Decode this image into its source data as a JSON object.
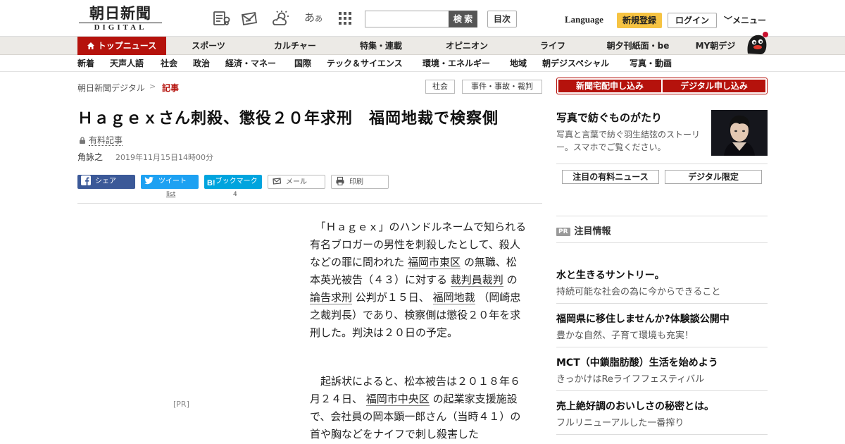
{
  "header": {
    "logo_jp": "朝日新聞",
    "logo_sub": "DIGITAL",
    "font_icon_big": "あ",
    "font_icon_small": "あ",
    "search_placeholder": "",
    "search_label": "検 索",
    "toc_label": "目次",
    "language_label": "Language",
    "signup_label": "新規登録",
    "login_label": "ログイン",
    "menu_label": "メニュー"
  },
  "main_nav": [
    "トップニュース",
    "スポーツ",
    "カルチャー",
    "特集・連載",
    "オピニオン",
    "ライフ",
    "朝夕刊紙面・be",
    "MY朝デジ"
  ],
  "sub_nav": [
    "新着",
    "天声人語",
    "社会",
    "政治",
    "経済・マネー",
    "国際",
    "テック＆サイエンス",
    "環境・エネルギー",
    "地域",
    "朝デジスペシャル",
    "写真・動画"
  ],
  "breadcrumb": {
    "root": "朝日新聞デジタル",
    "sep": ">",
    "current": "記事"
  },
  "tags": [
    "社会",
    "事件・事故・裁判"
  ],
  "article": {
    "title": "Ｈａｇｅｘさん刺殺、懲役２０年求刑　福岡地裁で検察側",
    "paid_label": "有料記事",
    "author": "角詠之",
    "date": "2019年11月15日14時00分",
    "share": {
      "facebook": "シェア",
      "twitter": "ツイート",
      "hatena": "ブックマーク",
      "mail": "メール",
      "print": "印刷",
      "twitter_count": "list",
      "hatena_count": "4"
    },
    "ad_label": "[PR]",
    "p1": {
      "t1": "「Ｈａｇｅｘ」のハンドルネームで知られる有名ブロガーの男性を刺殺したとして、殺人などの罪に問われた ",
      "l1": "福岡市東区",
      "t2": " の無職、松本英光被告（４３）に対する ",
      "l2": "裁判員裁判",
      "t3": " の ",
      "l3": "論告求刑",
      "t4": " 公判が１５日、 ",
      "l4": "福岡地裁",
      "t5": " （岡崎忠之裁判長）であり、検察側は懲役２０年を求刑した。判決は２０日の予定。"
    },
    "p2": {
      "t1": "起訴状によると、松本被告は２０１８年６月２４日、 ",
      "l1": "福岡市中央区",
      "t2": " の起業家支援施設で、会社員の岡本顕一郎さん（当時４１）の首や胸などをナイフで刺し殺害した"
    }
  },
  "sidebar": {
    "subscribe_paper": "新聞宅配申し込み",
    "subscribe_digital": "デジタル申し込み",
    "feature_title": "写真で紡ぐものがたり",
    "feature_desc": "写真と言葉で紡ぐ羽生結弦のストーリー。スマホでご覧ください。",
    "pick_paid": "注目の有料ニュース",
    "pick_digital": "デジタル限定",
    "pr_badge": "PR",
    "pr_heading": "注目情報",
    "ads": [
      {
        "title": "水と生きるサントリー。",
        "desc": "持続可能な社会の為に今からできること"
      },
      {
        "title": "福岡県に移住しませんか?体験談公開中",
        "desc": "豊かな自然、子育て環境も充実！"
      },
      {
        "title": "MCT（中鎖脂肪酸）生活を始めよう",
        "desc": "きっかけはReライフフェスティバル"
      },
      {
        "title": "売上絶好調のおいしさの秘密とは。",
        "desc": "フルリニューアルした一番搾り"
      }
    ]
  },
  "colors": {
    "brand_red": "#b5120c",
    "facebook": "#3b5998",
    "twitter": "#1da1f2",
    "hatena": "#00a4de",
    "signup_yellow": "#f6c342"
  }
}
